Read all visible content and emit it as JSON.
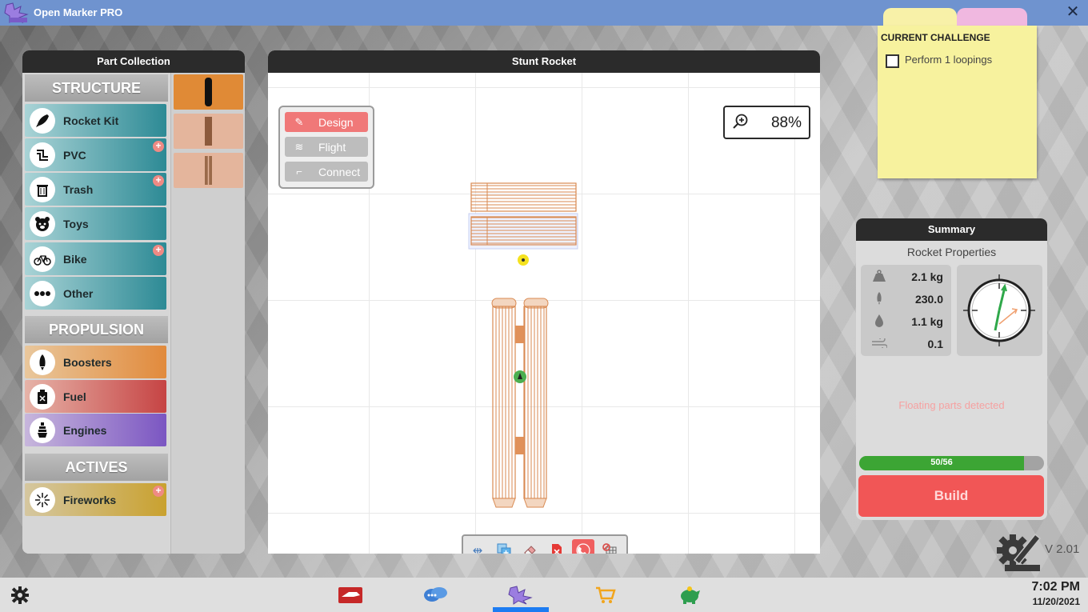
{
  "app": {
    "title": "Open Marker PRO"
  },
  "part_collection": {
    "title": "Part Collection",
    "sections": [
      {
        "label": "STRUCTURE"
      },
      {
        "label": "PROPULSION"
      },
      {
        "label": "ACTIVES"
      }
    ],
    "items": [
      {
        "label": "Rocket Kit",
        "icon": "rocket-icon"
      },
      {
        "label": "PVC",
        "icon": "pipe-icon"
      },
      {
        "label": "Trash",
        "icon": "trash-icon"
      },
      {
        "label": "Toys",
        "icon": "teddy-icon"
      },
      {
        "label": "Bike",
        "icon": "bike-icon"
      },
      {
        "label": "Other",
        "icon": "more-icon"
      },
      {
        "label": "Boosters",
        "icon": "booster-icon"
      },
      {
        "label": "Fuel",
        "icon": "fuel-icon"
      },
      {
        "label": "Engines",
        "icon": "engine-icon"
      },
      {
        "label": "Fireworks",
        "icon": "firework-icon"
      }
    ]
  },
  "main": {
    "title": "Stunt Rocket",
    "modes": [
      {
        "label": "Design",
        "icon": "design-icon"
      },
      {
        "label": "Flight",
        "icon": "flight-icon"
      },
      {
        "label": "Connect",
        "icon": "connect-icon"
      }
    ],
    "zoom_value": "88%"
  },
  "challenge": {
    "title": "CURRENT CHALLENGE",
    "task": "Perform 1 loopings"
  },
  "summary": {
    "title": "Summary",
    "subtitle": "Rocket Properties",
    "mass": "2.1 kg",
    "thrust": "230.0",
    "fuel": "1.1 kg",
    "drag": "0.1",
    "warning": "Floating parts detected",
    "parts_count": "50/56",
    "parts_fraction": 0.893,
    "build_label": "Build"
  },
  "version": "V 2.01",
  "clock": {
    "time": "7:02 PM",
    "date": "11/20/2021"
  },
  "colors": {
    "accent": "#6f93cf",
    "build": "#f15656",
    "progress": "#3ca534",
    "design_mode": "#f07878"
  }
}
